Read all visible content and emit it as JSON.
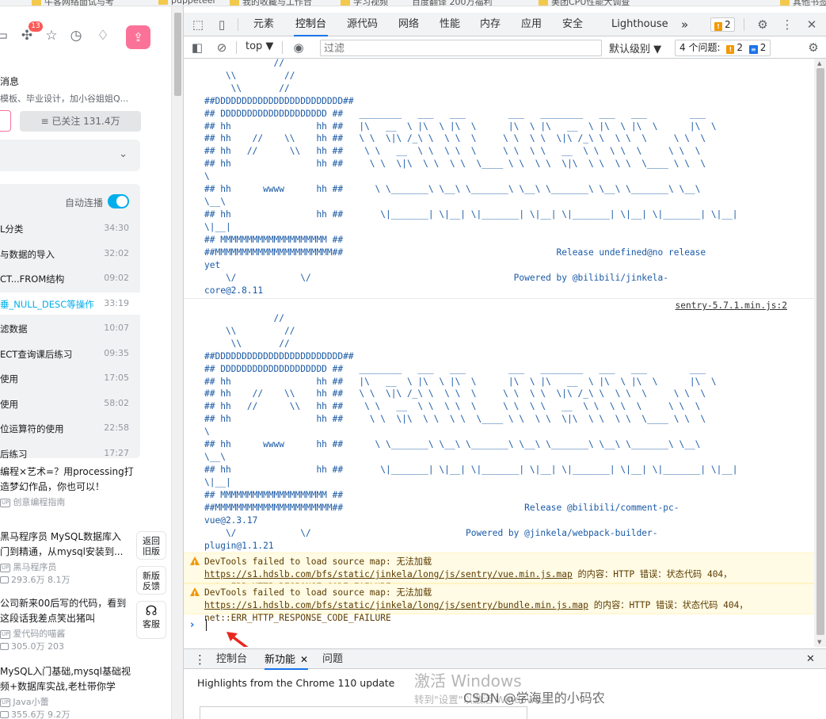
{
  "bookmarks": [
    "前端问题",
    "牛客网络面试与考",
    "puppeteer",
    "我的收藏与工作台",
    "学习视频",
    "百度翻译 200万福利",
    "美团CPU性能大调查",
    "其他书签"
  ],
  "left": {
    "icons": [
      "message-icon",
      "dynamic-icon",
      "favorite-icon",
      "history-icon",
      "creation-icon"
    ],
    "dynamic_badge": "13",
    "upload_icon": "upload-icon",
    "msg_title": "消息",
    "msg_desc": "模板、毕业设计，加小谷姐姐Q...",
    "follow_label": "≡ 已关注 131.4万",
    "autoplay_label": "自动连播",
    "playlist": [
      {
        "title": "L分类",
        "dur": "34:30",
        "active": false
      },
      {
        "title": "与数据的导入",
        "dur": "32:02",
        "active": false
      },
      {
        "title": "CT...FROM结构",
        "dur": "09:02",
        "active": false
      },
      {
        "title": "垂_NULL_DESC等操作",
        "dur": "33:19",
        "active": true
      },
      {
        "title": "滤数据",
        "dur": "10:07",
        "active": false
      },
      {
        "title": "ECT查询课后练习",
        "dur": "09:35",
        "active": false
      },
      {
        "title": "使用",
        "dur": "17:05",
        "active": false
      },
      {
        "title": "使用",
        "dur": "58:02",
        "active": false
      },
      {
        "title": "位运算符的使用",
        "dur": "22:58",
        "active": false
      },
      {
        "title": "后练习",
        "dur": "17:27",
        "active": false
      }
    ],
    "recommend": [
      {
        "title1": "编程×艺术=？用processing打",
        "title2": "造梦幻作品，你也可以！",
        "user": "创意编程指南",
        "stats": ""
      },
      {
        "title1": "黑马程序员 MySQL数据库入",
        "title2": "门到精通，从mysql安装到...",
        "user": "黑马程序员",
        "stats": "293.6万   8.1万"
      },
      {
        "title1": "公司新来00后写的代码，看到",
        "title2": "这段话我差点笑出猪叫",
        "user": "爱代码的喵酱",
        "stats": "305.0万   203"
      },
      {
        "title1": "MySQL入门基础,mysql基础视",
        "title2": "频+数据库实战,老杜带你学",
        "user": "Java小蕾",
        "stats": "355.6万   9.2万"
      }
    ],
    "tools": [
      "返回 旧版",
      "新版 反馈",
      "客服"
    ]
  },
  "devtools": {
    "tabs": [
      "元素",
      "控制台",
      "源代码",
      "网络",
      "性能",
      "内存",
      "应用",
      "安全",
      "Lighthouse"
    ],
    "active_tab": "控制台",
    "more": "»",
    "issue_badge_count": "2",
    "context": "top ▼",
    "filter_placeholder": "过滤",
    "level": "默认级别 ▼",
    "issues_label": "4 个问题:",
    "issues_warn": "2",
    "issues_info": "2",
    "banner1": "             //\n    \\\\         //\n     \\\\       //\n##DDDDDDDDDDDDDDDDDDDDDDDD##\n## DDDDDDDDDDDDDDDDDDDD ##   ________   ___   ___        ___   ________   ___   ___        ___\n## hh                hh ##   |\\   __  \\ |\\  \\ |\\  \\      |\\  \\ |\\   __  \\ |\\  \\ |\\  \\      |\\  \\\n## hh    //    \\\\    hh ##   \\ \\  \\|\\ /_\\ \\  \\ \\  \\     \\ \\  \\ \\  \\|\\ /_\\ \\  \\ \\  \\     \\ \\  \\\n## hh   //      \\\\   hh ##    \\ \\   __  \\ \\  \\ \\  \\     \\ \\  \\ \\   __  \\ \\  \\ \\  \\     \\ \\  \\\n## hh                hh ##     \\ \\  \\|\\  \\ \\  \\ \\  \\____ \\ \\  \\ \\  \\|\\  \\ \\  \\ \\  \\____ \\ \\  \\\n",
    "banner1_b": "## hh      wwww      hh ##      \\ \\_______\\ \\__\\ \\_______\\ \\__\\ \\_______\\ \\__\\ \\_______\\ \\__\\\n",
    "banner1_c": "## hh                hh ##       \\|_______| \\|__| \\|_______| \\|__| \\|_______| \\|__| \\|_______| \\|__|\n",
    "banner1_d": "## MMMMMMMMMMMMMMMMMMMM ##\n##MMMMMMMMMMMMMMMMMMMMMM##                                        Release undefined@no release",
    "banner1_e": "    \\/            \\/                                      Powered by @bilibili/jinkela-",
    "wrap1": [
      "\\",
      "\\__\\",
      "\\|__|",
      "yet",
      "core@2.8.11"
    ],
    "source_link": "sentry-5.7.1.min.js:2",
    "banner2_d": "## MMMMMMMMMMMMMMMMMMMM ##\n##MMMMMMMMMMMMMMMMMMMMMM##                                  Release @bilibili/comment-pc-",
    "banner2_e": "    \\/            \\/                             Powered by @jinkela/webpack-builder-",
    "wrap2": [
      "\\",
      "\\__\\",
      "\\|__|",
      "vue@2.3.17",
      "plugin@1.1.21"
    ],
    "warnings": [
      {
        "pre": "DevTools failed to load source map: 无法加载 ",
        "link": "https://s1.hdslb.com/bfs/static/jinkela/long/js/sentry/vue.min.js.map",
        "post": " 的内容：HTTP 错误：状态代码 404，net::ERR_HTTP_RESPONSE_CODE_FAILURE"
      },
      {
        "pre": "DevTools failed to load source map: 无法加载 ",
        "link": "https://s1.hdslb.com/bfs/static/jinkela/long/js/sentry/bundle.min.js.map",
        "post": " 的内容：HTTP 错误：状态代码 404，net::ERR_HTTP_RESPONSE_CODE_FAILURE"
      }
    ],
    "prompt": "›",
    "drawer_tabs": [
      "控制台",
      "新功能",
      "问题"
    ],
    "drawer_active": "新功能",
    "highlights": "Highlights from the Chrome 110 update"
  },
  "watermark": {
    "line1": "激活 Windows",
    "line2": "转到\"设置\"以激活 Windows。",
    "csdn": "CSDN @学海里的小码农"
  },
  "colors": {
    "accent_blue": "#1a73e8",
    "bili_pink": "#fb7299",
    "bili_blue": "#00aeec",
    "warn_bg": "#fffbe5",
    "banner_text": "#1a5aa6"
  }
}
